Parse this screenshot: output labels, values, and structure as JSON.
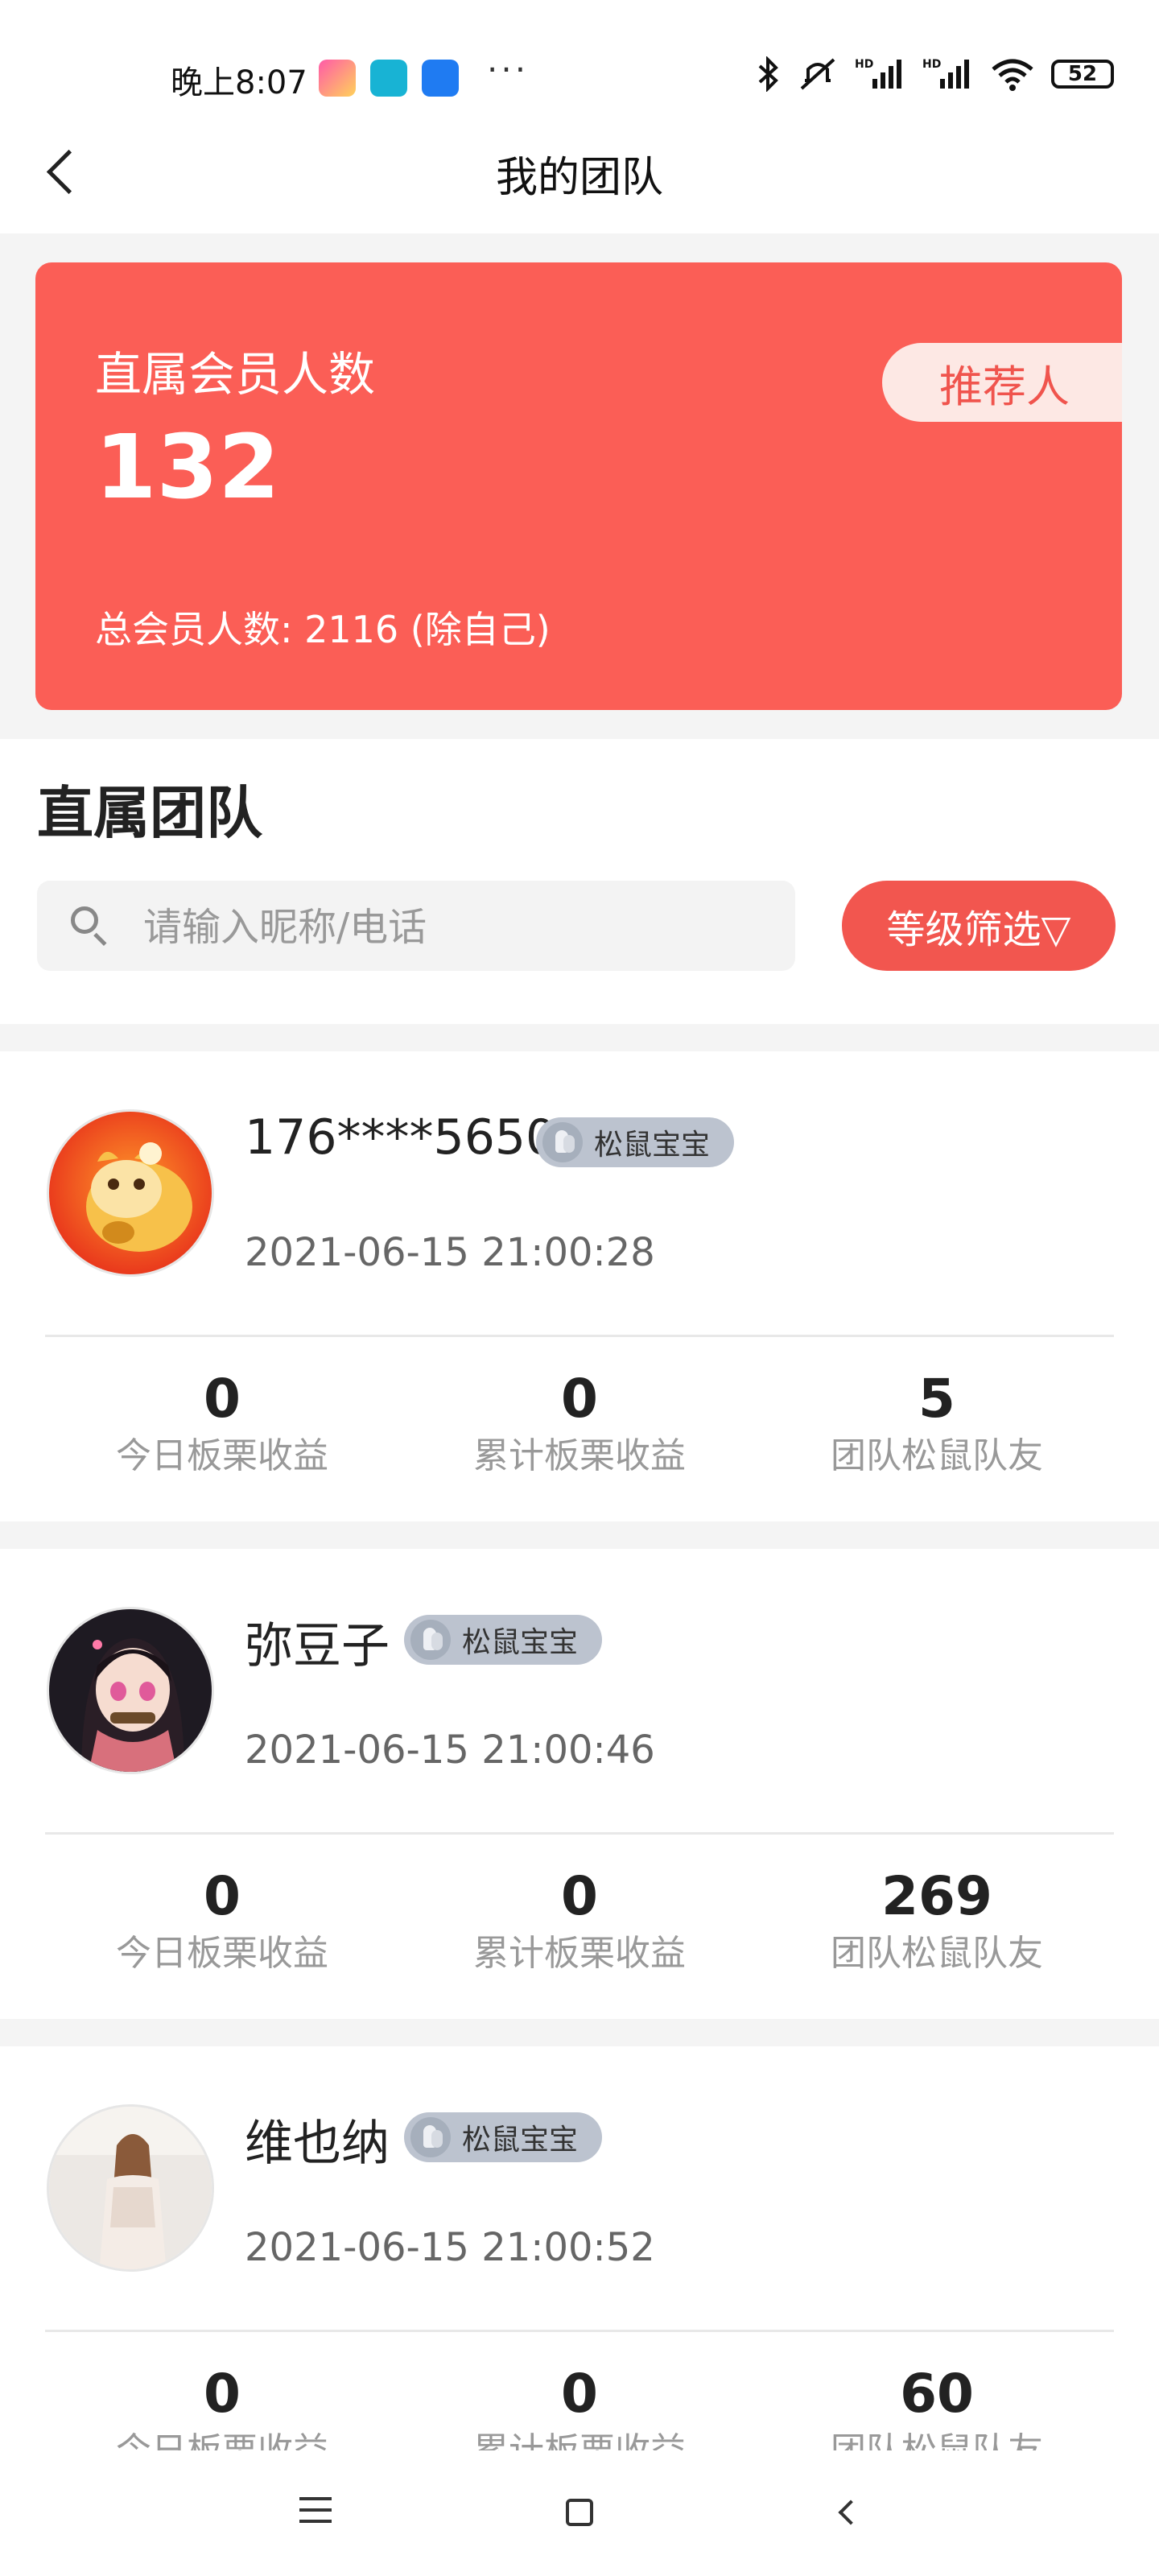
{
  "status_bar": {
    "time": "晚上8:07",
    "dots": "···",
    "battery": "52",
    "icons": [
      "app-icon-promo",
      "app-icon-camel",
      "app-icon-zhihu",
      "bluetooth-icon",
      "mute-icon",
      "hd-signal-icon",
      "hd-signal-icon",
      "wifi-icon",
      "battery-icon"
    ]
  },
  "header": {
    "title": "我的团队"
  },
  "summary": {
    "direct_label": "直属会员人数",
    "direct_value": "132",
    "total_text": "总会员人数: 2116 (除自己)",
    "recommender_label": "推荐人",
    "accent_color": "#fb5e56"
  },
  "section": {
    "title": "直属团队",
    "search_placeholder": "请输入昵称/电话",
    "filter_label": "等级筛选▽"
  },
  "stat_labels": [
    "今日板栗收益",
    "累计板栗收益",
    "团队松鼠队友"
  ],
  "members": [
    {
      "name": "176****5650",
      "badge": "松鼠宝宝",
      "date": "2021-06-15 21:00:28",
      "today": "0",
      "total": "0",
      "team": "5"
    },
    {
      "name": "弥豆子",
      "badge": "松鼠宝宝",
      "date": "2021-06-15 21:00:46",
      "today": "0",
      "total": "0",
      "team": "269"
    },
    {
      "name": "维也纳",
      "badge": "松鼠宝宝",
      "date": "2021-06-15 21:00:52",
      "today": "0",
      "total": "0",
      "team": "60"
    }
  ]
}
